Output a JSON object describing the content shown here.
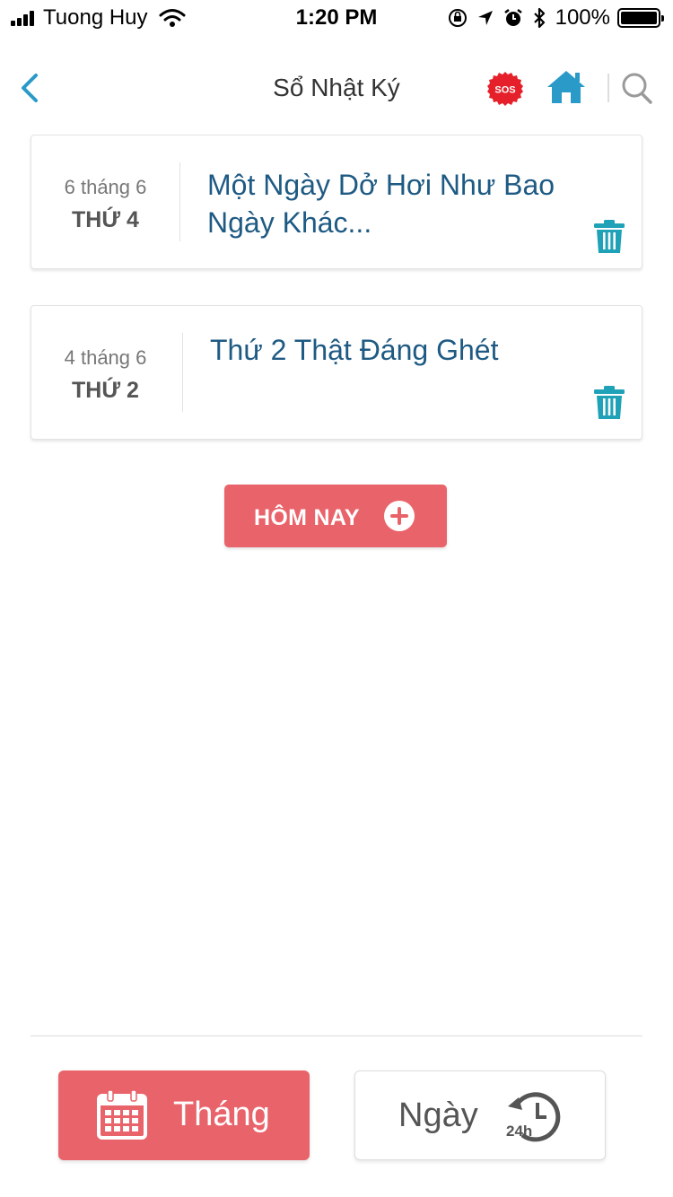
{
  "status_bar": {
    "carrier": "Tuong Huy",
    "time": "1:20 PM",
    "battery": "100%"
  },
  "nav": {
    "title": "Sổ Nhật Ký",
    "sos_label": "SOS"
  },
  "entries": [
    {
      "date": "6 tháng 6",
      "weekday": "THỨ 4",
      "title": "Một Ngày Dở Hơi Như Bao Ngày Khác..."
    },
    {
      "date": "4 tháng 6",
      "weekday": "THỨ 2",
      "title": "Thứ 2 Thật Đáng Ghét"
    }
  ],
  "today_button": {
    "label": "HÔM NAY"
  },
  "tabs": {
    "month": "Tháng",
    "day": "Ngày",
    "day_icon_text": "24h"
  },
  "colors": {
    "accent": "#e9636a",
    "title_blue": "#1e5a83",
    "icon_blue": "#2a9ac9",
    "trash_teal": "#1fa2b8",
    "sos_red": "#e5202a"
  }
}
